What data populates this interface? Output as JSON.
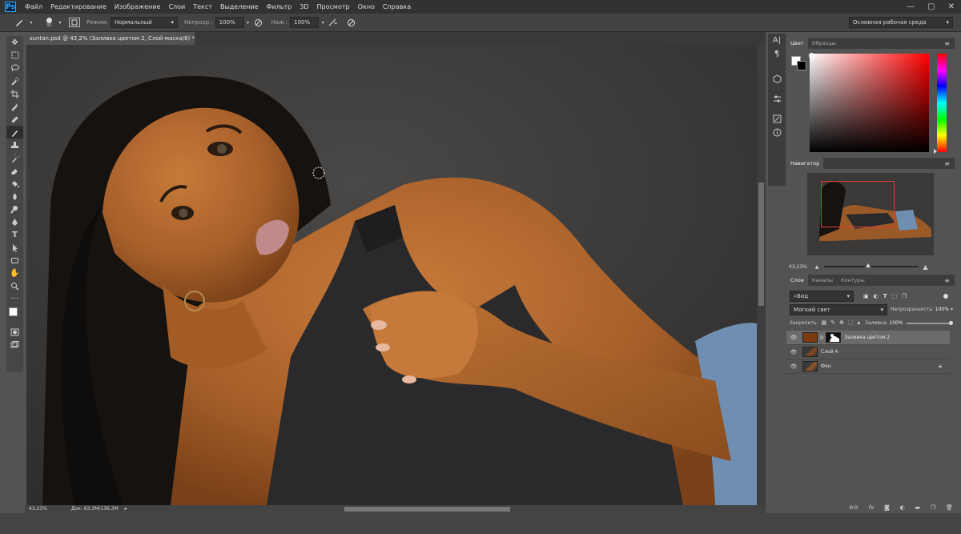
{
  "app": {
    "logo": "Ps",
    "window_controls": [
      "—",
      "▢",
      "✕"
    ]
  },
  "menu": [
    "Файл",
    "Редактирование",
    "Изображение",
    "Слои",
    "Текст",
    "Выделение",
    "Фильтр",
    "3D",
    "Просмотр",
    "Окно",
    "Справка"
  ],
  "options": {
    "brush_size": "30",
    "mode_label": "Режим:",
    "mode_value": "Нормальный",
    "opacity_label": "Непрозр.:",
    "opacity_value": "100%",
    "pressure_label": "Наж.:",
    "pressure_value": "100%",
    "workspace": "Основная рабочая среда"
  },
  "document": {
    "tab_title": "suntan.psd @ 43,2% (Заливка цветом 2, Слой-маска/8) *",
    "zoom": "43,23%",
    "doc_size": "Док: 63,3M/136,3M"
  },
  "color_panel": {
    "tabs": [
      "Цвет",
      "Образцы"
    ],
    "active_tab": "Цвет",
    "base_hue": "#ff0000"
  },
  "navigator": {
    "title": "Навигатор",
    "zoom": "43,23%",
    "view_box_color": "#e0393c"
  },
  "layers_panel": {
    "tabs": [
      "Слои",
      "Каналы",
      "Контуры"
    ],
    "active_tab": "Слои",
    "filter_label": "Вид",
    "blend_mode": "Мягкий свет",
    "opacity_label": "Непрозрачность:",
    "opacity_value": "100%",
    "lock_label": "Закрепить:",
    "fill_label": "Заливка:",
    "fill_value": "100%",
    "fill_color": "#7a3b10",
    "layers": [
      {
        "name": "Заливка цветом 2",
        "selected": true
      },
      {
        "name": "Слой 4",
        "selected": false
      },
      {
        "name": "Фон",
        "selected": false,
        "locked": true
      }
    ]
  },
  "toolbar": {
    "tools": [
      "move-icon",
      "marquee-icon",
      "lasso-icon",
      "quick-select-icon",
      "crop-icon",
      "eyedropper-icon",
      "healing-icon",
      "brush-icon",
      "stamp-icon",
      "history-brush-icon",
      "eraser-icon",
      "bucket-icon",
      "blur-icon",
      "dodge-icon",
      "pen-icon",
      "text-icon",
      "path-select-icon",
      "shape-icon",
      "hand-icon",
      "zoom-icon",
      "more-icon"
    ],
    "active": "brush-icon"
  }
}
